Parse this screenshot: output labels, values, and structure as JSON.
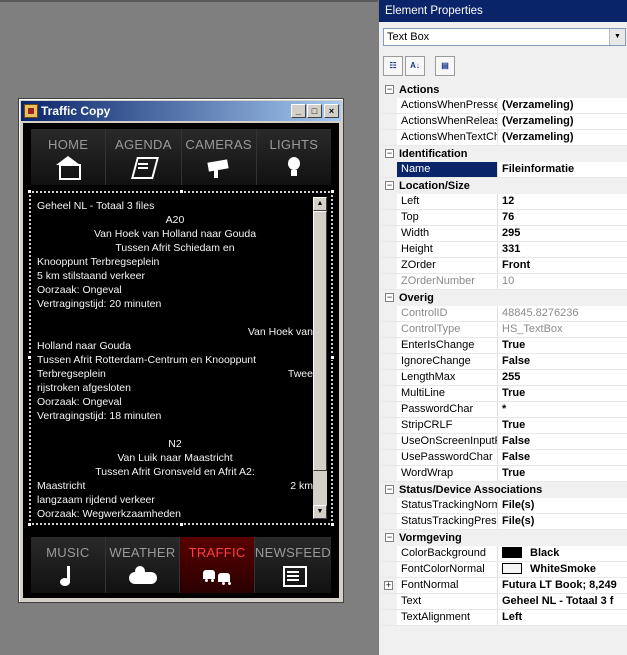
{
  "window": {
    "title": "Traffic Copy",
    "min_label": "_",
    "max_label": "□",
    "close_label": "×"
  },
  "nav_top": [
    {
      "label": "HOME",
      "icon": "house-icon"
    },
    {
      "label": "AGENDA",
      "icon": "agenda-icon"
    },
    {
      "label": "CAMERAS",
      "icon": "camera-icon"
    },
    {
      "label": "LIGHTS",
      "icon": "lightbulb-icon"
    }
  ],
  "nav_bottom": [
    {
      "label": "MUSIC",
      "icon": "music-note-icon"
    },
    {
      "label": "WEATHER",
      "icon": "weather-cloud-icon"
    },
    {
      "label": "TRAFFIC",
      "icon": "traffic-cars-icon",
      "active": true
    },
    {
      "label": "NEWSFEED",
      "icon": "newsfeed-icon"
    }
  ],
  "textbox": {
    "lines": [
      {
        "t": "Geheel NL - Totaal 3 files",
        "a": "l"
      },
      {
        "t": "A20",
        "a": "c"
      },
      {
        "t": "Van Hoek van Holland naar Gouda",
        "a": "c"
      },
      {
        "t": "Tussen Afrit Schiedam en",
        "a": "c"
      },
      {
        "t": "Knooppunt Terbregseplein",
        "a": "l"
      },
      {
        "t": "5 km stilstaand verkeer",
        "a": "l"
      },
      {
        "t": "Oorzaak: Ongeval",
        "a": "l"
      },
      {
        "t": "Vertragingstijd: 20 minuten",
        "a": "l"
      },
      {
        "t": "",
        "a": "gap"
      },
      {
        "t": "Van Hoek van",
        "a": "r"
      },
      {
        "t": "Holland naar Gouda",
        "a": "l"
      },
      {
        "t": "Tussen Afrit Rotterdam-Centrum en Knooppunt",
        "a": "l"
      },
      {
        "t": "Terbregseplein",
        "t2": "Twee",
        "a": "sp"
      },
      {
        "t": "rijstroken afgesloten",
        "a": "l"
      },
      {
        "t": "Oorzaak: Ongeval",
        "a": "l"
      },
      {
        "t": "Vertragingstijd: 18 minuten",
        "a": "l"
      },
      {
        "t": "",
        "a": "gap"
      },
      {
        "t": "N2",
        "a": "c"
      },
      {
        "t": "Van Luik naar Maastricht",
        "a": "c"
      },
      {
        "t": "Tussen Afrit Gronsveld en Afrit A2:",
        "a": "c"
      },
      {
        "t": "Maastricht",
        "t2": "2 km",
        "a": "sp"
      },
      {
        "t": "langzaam rijdend verkeer",
        "a": "l"
      },
      {
        "t": "Oorzaak: Wegwerkzaamheden",
        "a": "l"
      }
    ]
  },
  "props": {
    "title": "Element Properties",
    "selected_type": "Text Box",
    "sections": [
      {
        "name": "Actions",
        "rows": [
          {
            "k": "ActionsWhenPresse",
            "v": "(Verzameling)"
          },
          {
            "k": "ActionsWhenReleas",
            "v": "(Verzameling)"
          },
          {
            "k": "ActionsWhenTextCh",
            "v": "(Verzameling)"
          }
        ]
      },
      {
        "name": "Identification",
        "rows": [
          {
            "k": "Name",
            "v": "Fileinformatie",
            "sel": true
          }
        ]
      },
      {
        "name": "Location/Size",
        "rows": [
          {
            "k": "Left",
            "v": "12"
          },
          {
            "k": "Top",
            "v": "76"
          },
          {
            "k": "Width",
            "v": "295"
          },
          {
            "k": "Height",
            "v": "331"
          },
          {
            "k": "ZOrder",
            "v": "Front"
          },
          {
            "k": "ZOrderNumber",
            "v": "10",
            "dim": true
          }
        ]
      },
      {
        "name": "Overig",
        "rows": [
          {
            "k": "ControlID",
            "v": "48845.8276236",
            "dim": true
          },
          {
            "k": "ControlType",
            "v": "HS_TextBox",
            "dim": true
          },
          {
            "k": "EnterIsChange",
            "v": "True"
          },
          {
            "k": "IgnoreChange",
            "v": "False"
          },
          {
            "k": "LengthMax",
            "v": "255"
          },
          {
            "k": "MultiLine",
            "v": "True"
          },
          {
            "k": "PasswordChar",
            "v": "*"
          },
          {
            "k": "StripCRLF",
            "v": "True"
          },
          {
            "k": "UseOnScreenInputF",
            "v": "False"
          },
          {
            "k": "UsePasswordChar",
            "v": "False"
          },
          {
            "k": "WordWrap",
            "v": "True"
          }
        ]
      },
      {
        "name": "Status/Device Associations",
        "rows": [
          {
            "k": "StatusTrackingNorm",
            "v": "File(s)"
          },
          {
            "k": "StatusTrackingPress",
            "v": "File(s)"
          }
        ]
      },
      {
        "name": "Vormgeving",
        "rows": [
          {
            "k": "ColorBackground",
            "v": "Black",
            "swatch": "#000000"
          },
          {
            "k": "FontColorNormal",
            "v": "WhiteSmoke",
            "swatch": "#f5f5f5"
          },
          {
            "k": "FontNormal",
            "v": "Futura LT Book; 8,249",
            "expand": true
          },
          {
            "k": "Text",
            "v": "Geheel NL - Totaal 3 f"
          },
          {
            "k": "TextAlignment",
            "v": "Left"
          }
        ]
      }
    ]
  },
  "colors": {
    "active_nav": "#ff4040",
    "title_bar": "#0a246a"
  }
}
